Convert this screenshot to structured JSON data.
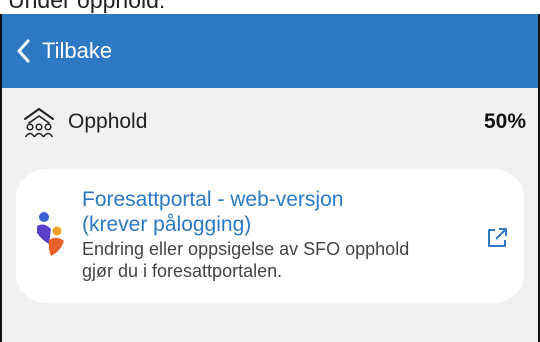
{
  "screen": {
    "caption": "Under opphold:"
  },
  "navbar": {
    "back_label": "Tilbake"
  },
  "opphold": {
    "label": "Opphold",
    "value": "50%"
  },
  "portal_card": {
    "title_line1": "Foresattportal - web-versjon",
    "title_line2": "(krever pålogging)",
    "desc_line1": "Endring eller oppsigelse av SFO opphold",
    "desc_line2": "gjør du i foresattportalen."
  },
  "icons": {
    "back": "chevron-left-icon",
    "opphold": "house-people-icon",
    "portal": "family-logo-icon",
    "external": "external-link-icon"
  },
  "colors": {
    "navbar": "#2d79c3",
    "link": "#2d79c3",
    "background": "#f1f1f3",
    "card": "#ffffff"
  }
}
